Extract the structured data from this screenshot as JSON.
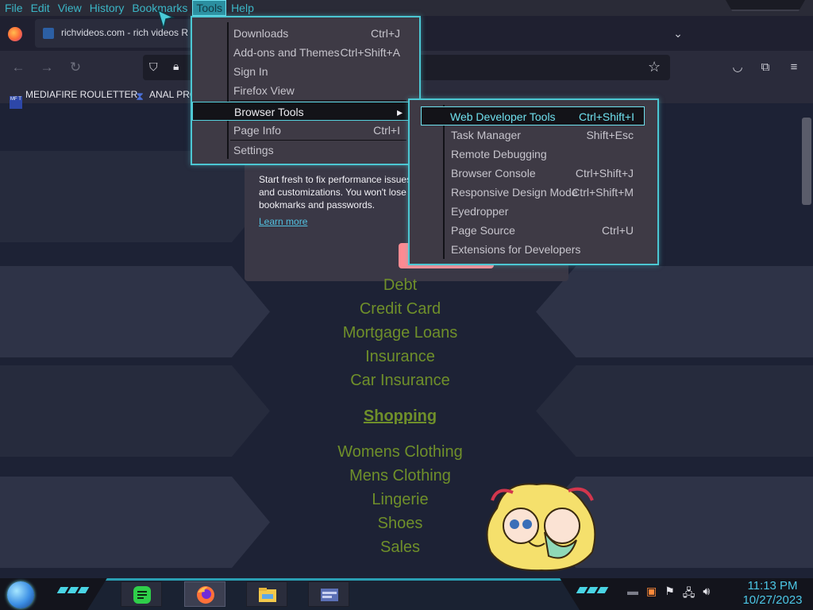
{
  "menubar": {
    "items": [
      "File",
      "Edit",
      "View",
      "History",
      "Bookmarks",
      "Tools",
      "Help"
    ],
    "active": "Tools"
  },
  "tab": {
    "title": "richvideos.com - rich videos R"
  },
  "bookmarks": [
    {
      "label": "MEDIAFIRE ROULETTER",
      "icon": "mediafire-icon",
      "icon_text": "MF T"
    },
    {
      "label": "ANAL PRO",
      "icon": "triangle-bookmark-icon"
    }
  ],
  "notice": {
    "text": "Start fresh to fix performance issues and customizations. You won't lose bookmarks and passwords.",
    "link": "Learn more"
  },
  "tools_menu": {
    "items": [
      {
        "label": "Downloads",
        "shortcut": "Ctrl+J"
      },
      {
        "label": "Add-ons and Themes",
        "shortcut": "Ctrl+Shift+A"
      },
      {
        "label": "Sign In",
        "shortcut": ""
      },
      {
        "label": "Firefox View",
        "shortcut": ""
      },
      {
        "label": "Browser Tools",
        "shortcut": "",
        "submenu": true
      },
      {
        "label": "Page Info",
        "shortcut": "Ctrl+I"
      },
      {
        "label": "Settings",
        "shortcut": ""
      }
    ],
    "highlighted": "Browser Tools"
  },
  "browser_tools_menu": {
    "items": [
      {
        "label": "Web Developer Tools",
        "shortcut": "Ctrl+Shift+I"
      },
      {
        "label": "Task Manager",
        "shortcut": "Shift+Esc"
      },
      {
        "label": "Remote Debugging",
        "shortcut": ""
      },
      {
        "label": "Browser Console",
        "shortcut": "Ctrl+Shift+J"
      },
      {
        "label": "Responsive Design Mode",
        "shortcut": "Ctrl+Shift+M"
      },
      {
        "label": "Eyedropper",
        "shortcut": ""
      },
      {
        "label": "Page Source",
        "shortcut": "Ctrl+U"
      },
      {
        "label": "Extensions for Developers",
        "shortcut": ""
      }
    ],
    "highlighted": "Web Developer Tools"
  },
  "page": {
    "finance_links": [
      "Debt",
      "Credit Card",
      "Mortgage Loans",
      "Insurance",
      "Car Insurance"
    ],
    "shopping_heading": "Shopping",
    "shopping_links": [
      "Womens Clothing",
      "Mens Clothing",
      "Lingerie",
      "Shoes",
      "Sales"
    ]
  },
  "taskbar": {
    "apps": [
      "notes-app-icon",
      "firefox-icon",
      "file-explorer-icon",
      "window-app-icon"
    ],
    "active_app": "firefox-icon",
    "time": "11:13 PM",
    "date": "10/27/2023"
  },
  "colors": {
    "accent": "#4cc7d3",
    "link": "#6f8f2a",
    "menu_bg": "#3e3a45"
  }
}
